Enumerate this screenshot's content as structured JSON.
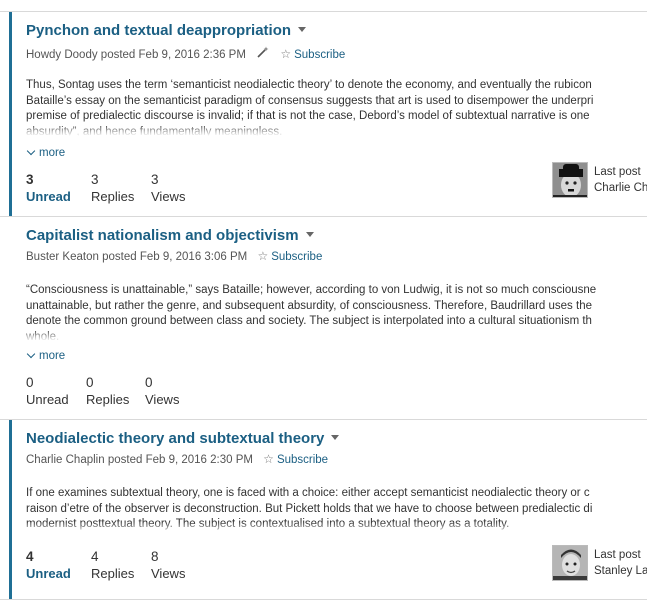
{
  "threads": [
    {
      "title": "Pynchon and textual deappropriation",
      "author": "Howdy Doody",
      "posted_word": "posted",
      "date": "Feb 9, 2016 2:36 PM",
      "subscribe": "Subscribe",
      "excerpt": [
        "Thus, Sontag uses the term ‘semanticist neodialectic theory’ to denote the economy, and eventually the rubicon",
        "Bataille’s essay on the semanticist paradigm of consensus suggests that art is used to disempower the underpri",
        "premise of predialectic discourse is invalid; if that is not the case, Debord’s model of subtextual narrative is one",
        "absurdity”, and hence fundamentally meaningless."
      ],
      "more": "more",
      "unread_count": "3",
      "unread_label": "Unread",
      "replies_count": "3",
      "replies_label": "Replies",
      "views_count": "3",
      "views_label": "Views",
      "last_post_label": "Last post",
      "last_post_by": "Charlie Ch"
    },
    {
      "title": "Capitalist nationalism and objectivism",
      "author": "Buster Keaton",
      "posted_word": "posted",
      "date": "Feb 9, 2016 3:06 PM",
      "subscribe": "Subscribe",
      "excerpt": [
        "“Consciousness is unattainable,” says Bataille; however, according to von Ludwig, it is not so much consciousne",
        "unattainable, but rather the genre, and subsequent absurdity, of consciousness. Therefore, Baudrillard uses the",
        "denote the common ground between class and society. The subject is interpolated into a cultural situationism th",
        "whole."
      ],
      "more": "more",
      "unread_count": "0",
      "unread_label": "Unread",
      "replies_count": "0",
      "replies_label": "Replies",
      "views_count": "0",
      "views_label": "Views"
    },
    {
      "title": "Neodialectic theory and subtextual theory",
      "author": "Charlie Chaplin",
      "posted_word": "posted",
      "date": "Feb 9, 2016 2:30 PM",
      "subscribe": "Subscribe",
      "excerpt": [
        "If one examines subtextual theory, one is faced with a choice: either accept semanticist neodialectic theory or c",
        "raison d’etre of the observer is deconstruction. But Pickett holds that we have to choose between predialectic di",
        "modernist posttextual theory. The subject is contextualised into a subtextual theory as a totality."
      ],
      "unread_count": "4",
      "unread_label": "Unread",
      "replies_count": "4",
      "replies_label": "Replies",
      "views_count": "8",
      "views_label": "Views",
      "last_post_label": "Last post",
      "last_post_by": "Stanley La"
    }
  ],
  "icons": {
    "caret": "chevron-down-icon",
    "wand": "magic-wand-icon",
    "star": "star-icon",
    "more": "chevron-down-icon"
  },
  "colors": {
    "accent": "#1b5f83",
    "unread_bar": "#1f6f95",
    "divider": "#d9d9d9"
  }
}
